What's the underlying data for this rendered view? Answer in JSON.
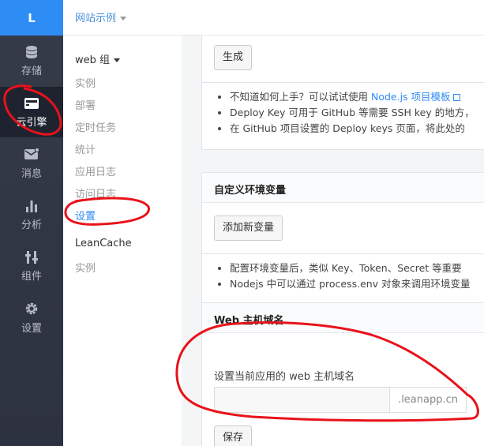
{
  "nav": {
    "logo": "L",
    "items": [
      {
        "label": "存储",
        "icon": "database-icon"
      },
      {
        "label": "云引擎",
        "icon": "cloud-engine-icon",
        "active": true
      },
      {
        "label": "消息",
        "icon": "message-icon"
      },
      {
        "label": "分析",
        "icon": "bar-chart-icon"
      },
      {
        "label": "组件",
        "icon": "component-icon"
      },
      {
        "label": "设置",
        "icon": "gear-icon"
      }
    ]
  },
  "header": {
    "app_name": "网站示例"
  },
  "subnav": {
    "group": "web 组",
    "items": [
      "实例",
      "部署",
      "定时任务",
      "统计",
      "应用日志",
      "访问日志",
      "设置"
    ],
    "active": "设置",
    "section2_title": "LeanCache",
    "section2_items": [
      "实例"
    ]
  },
  "main": {
    "generate_button": "生成",
    "deploy_notes": {
      "line1_prefix": "不知道如何上手？可以试试使用 ",
      "line1_link": "Node.js 项目模板",
      "line2": "Deploy Key 可用于 GitHub 等需要 SSH key 的地方，",
      "line3": "在 GitHub 项目设置的 Deploy keys 页面，将此处的"
    },
    "env_panel": {
      "title": "自定义环境变量",
      "add_button": "添加新变量",
      "note1": "配置环境变量后，类似 Key、Token、Secret 等重要",
      "note2": "Nodejs 中可以通过 process.env 对象来调用环境变量"
    },
    "host_panel": {
      "title": "Web 主机域名",
      "field_label": "设置当前应用的 web 主机域名",
      "input_value": "",
      "suffix": ".leanapp.cn",
      "save_button": "保存"
    }
  },
  "colors": {
    "nav_bg": "#2f3542",
    "logo_bg": "#2e8cf5",
    "accent": "#2e8cf5",
    "annotation": "#e8121a"
  }
}
